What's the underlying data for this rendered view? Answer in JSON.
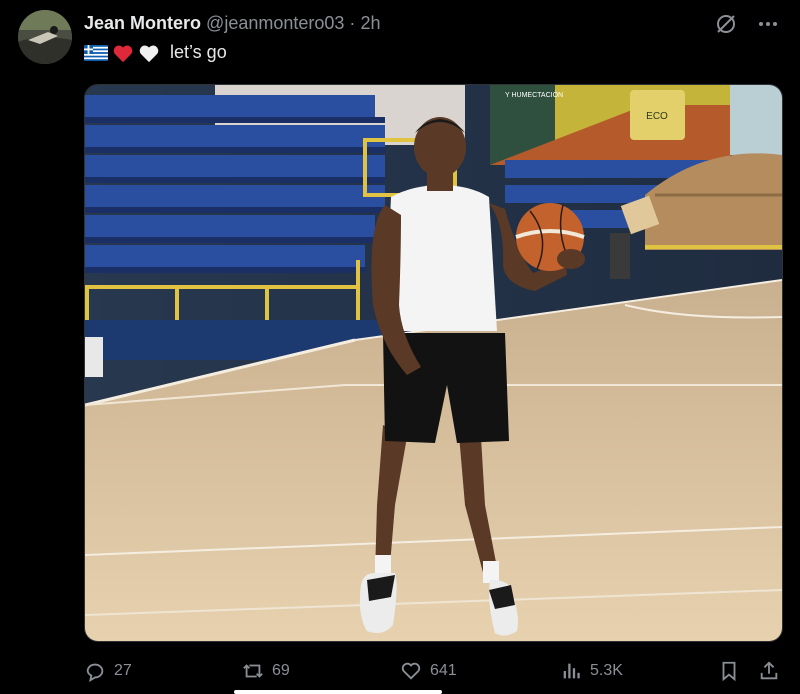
{
  "author": {
    "display_name": "Jean Montero",
    "handle": "@jeanmontero03",
    "time_sep": "·",
    "time": "2h",
    "avatar_icon": "avatar"
  },
  "header_icons": [
    "grok-icon",
    "more-icon"
  ],
  "tweet": {
    "emoji": [
      "greece-flag-icon",
      "red-heart-icon",
      "white-heart-icon"
    ],
    "text": "let’s go"
  },
  "media": {
    "signage_text": "Y HUMECTACIÓN",
    "product_label": "ECO"
  },
  "actions": {
    "replies": "27",
    "reposts": "69",
    "likes": "641",
    "views": "5.3K"
  },
  "colors": {
    "background": "#000000",
    "text": "#e7e9ea",
    "muted": "#8b9096"
  }
}
